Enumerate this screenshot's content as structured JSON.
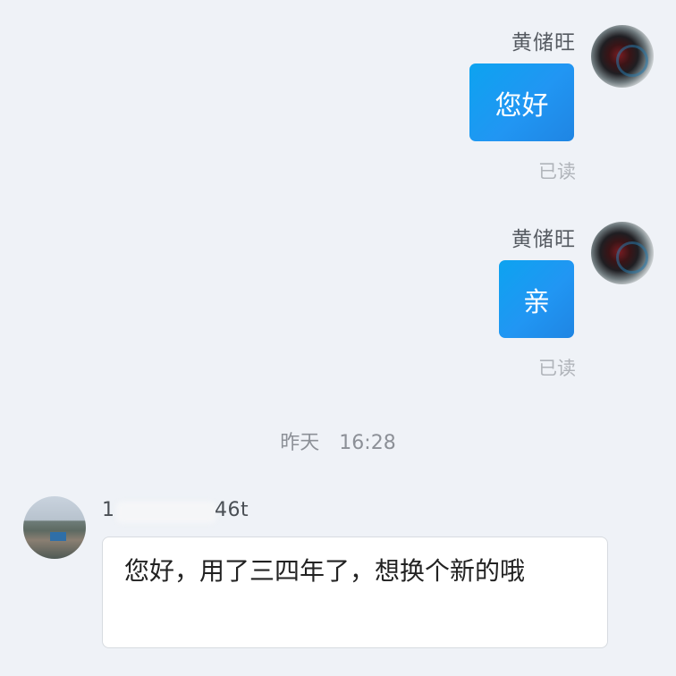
{
  "messages": [
    {
      "sender": "黄储旺",
      "text": "您好",
      "status": "已读"
    },
    {
      "sender": "黄储旺",
      "text": "亲",
      "status": "已读"
    }
  ],
  "divider": {
    "day": "昨天",
    "time": "16:28"
  },
  "incoming": {
    "sender_prefix": "1",
    "sender_suffix": "46t",
    "text": "您好，用了三四年了，想换个新的哦"
  },
  "icons": {
    "self_avatar": "user-avatar-icon",
    "other_avatar": "contact-avatar-icon"
  },
  "colors": {
    "background": "#eff2f7",
    "sent_bubble": "#1a9bf0",
    "received_bubble": "#ffffff",
    "read_status": "#b0b4ba"
  }
}
